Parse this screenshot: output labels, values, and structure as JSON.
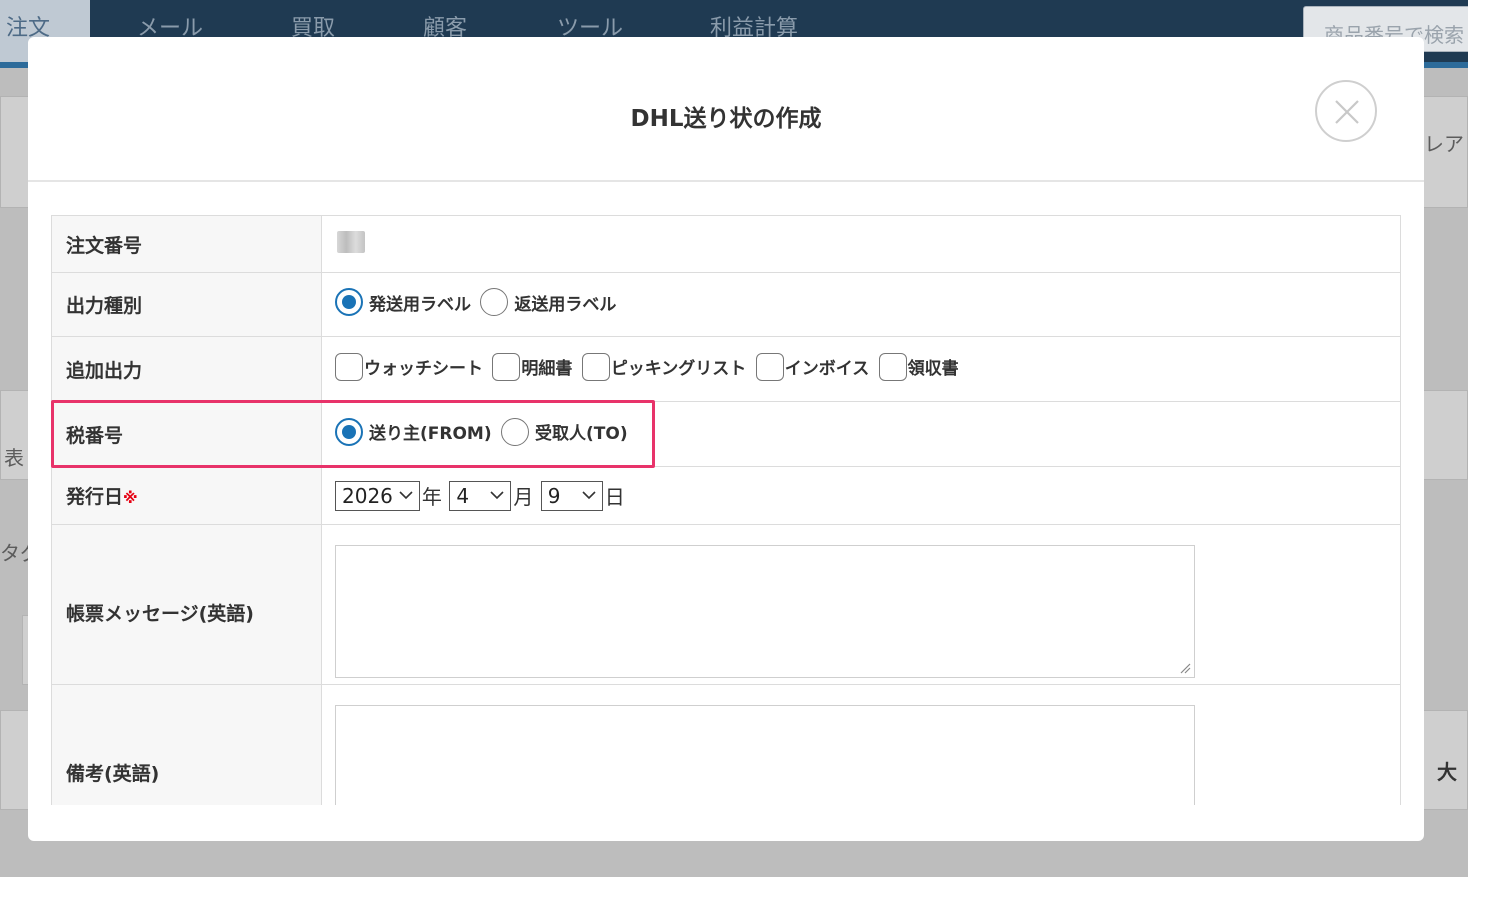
{
  "background_app": {
    "nav": {
      "items": [
        "注文",
        "メール",
        "買取",
        "顧客",
        "ツール",
        "利益計算"
      ],
      "search_placeholder": "商品番号で検索"
    },
    "fragments": {
      "right_top": "レアド",
      "left_mid": "表",
      "left_tab": "タグ",
      "right_bottom": "大"
    }
  },
  "modal": {
    "title": "DHL送り状の作成",
    "close_label": "×",
    "rows": {
      "order_number": {
        "label": "注文番号"
      },
      "output_type": {
        "label": "出力種別",
        "options": [
          "発送用ラベル",
          "返送用ラベル"
        ],
        "selected": "発送用ラベル"
      },
      "additional_output": {
        "label": "追加出力",
        "options": [
          "ウォッチシート",
          "明細書",
          "ピッキングリスト",
          "インボイス",
          "領収書"
        ]
      },
      "tax_number": {
        "label": "税番号",
        "options": [
          "送り主(FROM)",
          "受取人(TO)"
        ],
        "selected": "送り主(FROM)"
      },
      "issue_date": {
        "label": "発行日",
        "required_mark": "※",
        "year": "2026",
        "year_unit": "年",
        "month": "4",
        "month_unit": "月",
        "day": "9",
        "day_unit": "日"
      },
      "message": {
        "label": "帳票メッセージ(英語)",
        "value": ""
      },
      "remarks": {
        "label": "備考(英語)",
        "value": ""
      }
    }
  },
  "colors": {
    "nav_bg": "#1f3a52",
    "accent_blue": "#1a73b6",
    "highlight": "#e8336a",
    "required": "#e60012"
  }
}
